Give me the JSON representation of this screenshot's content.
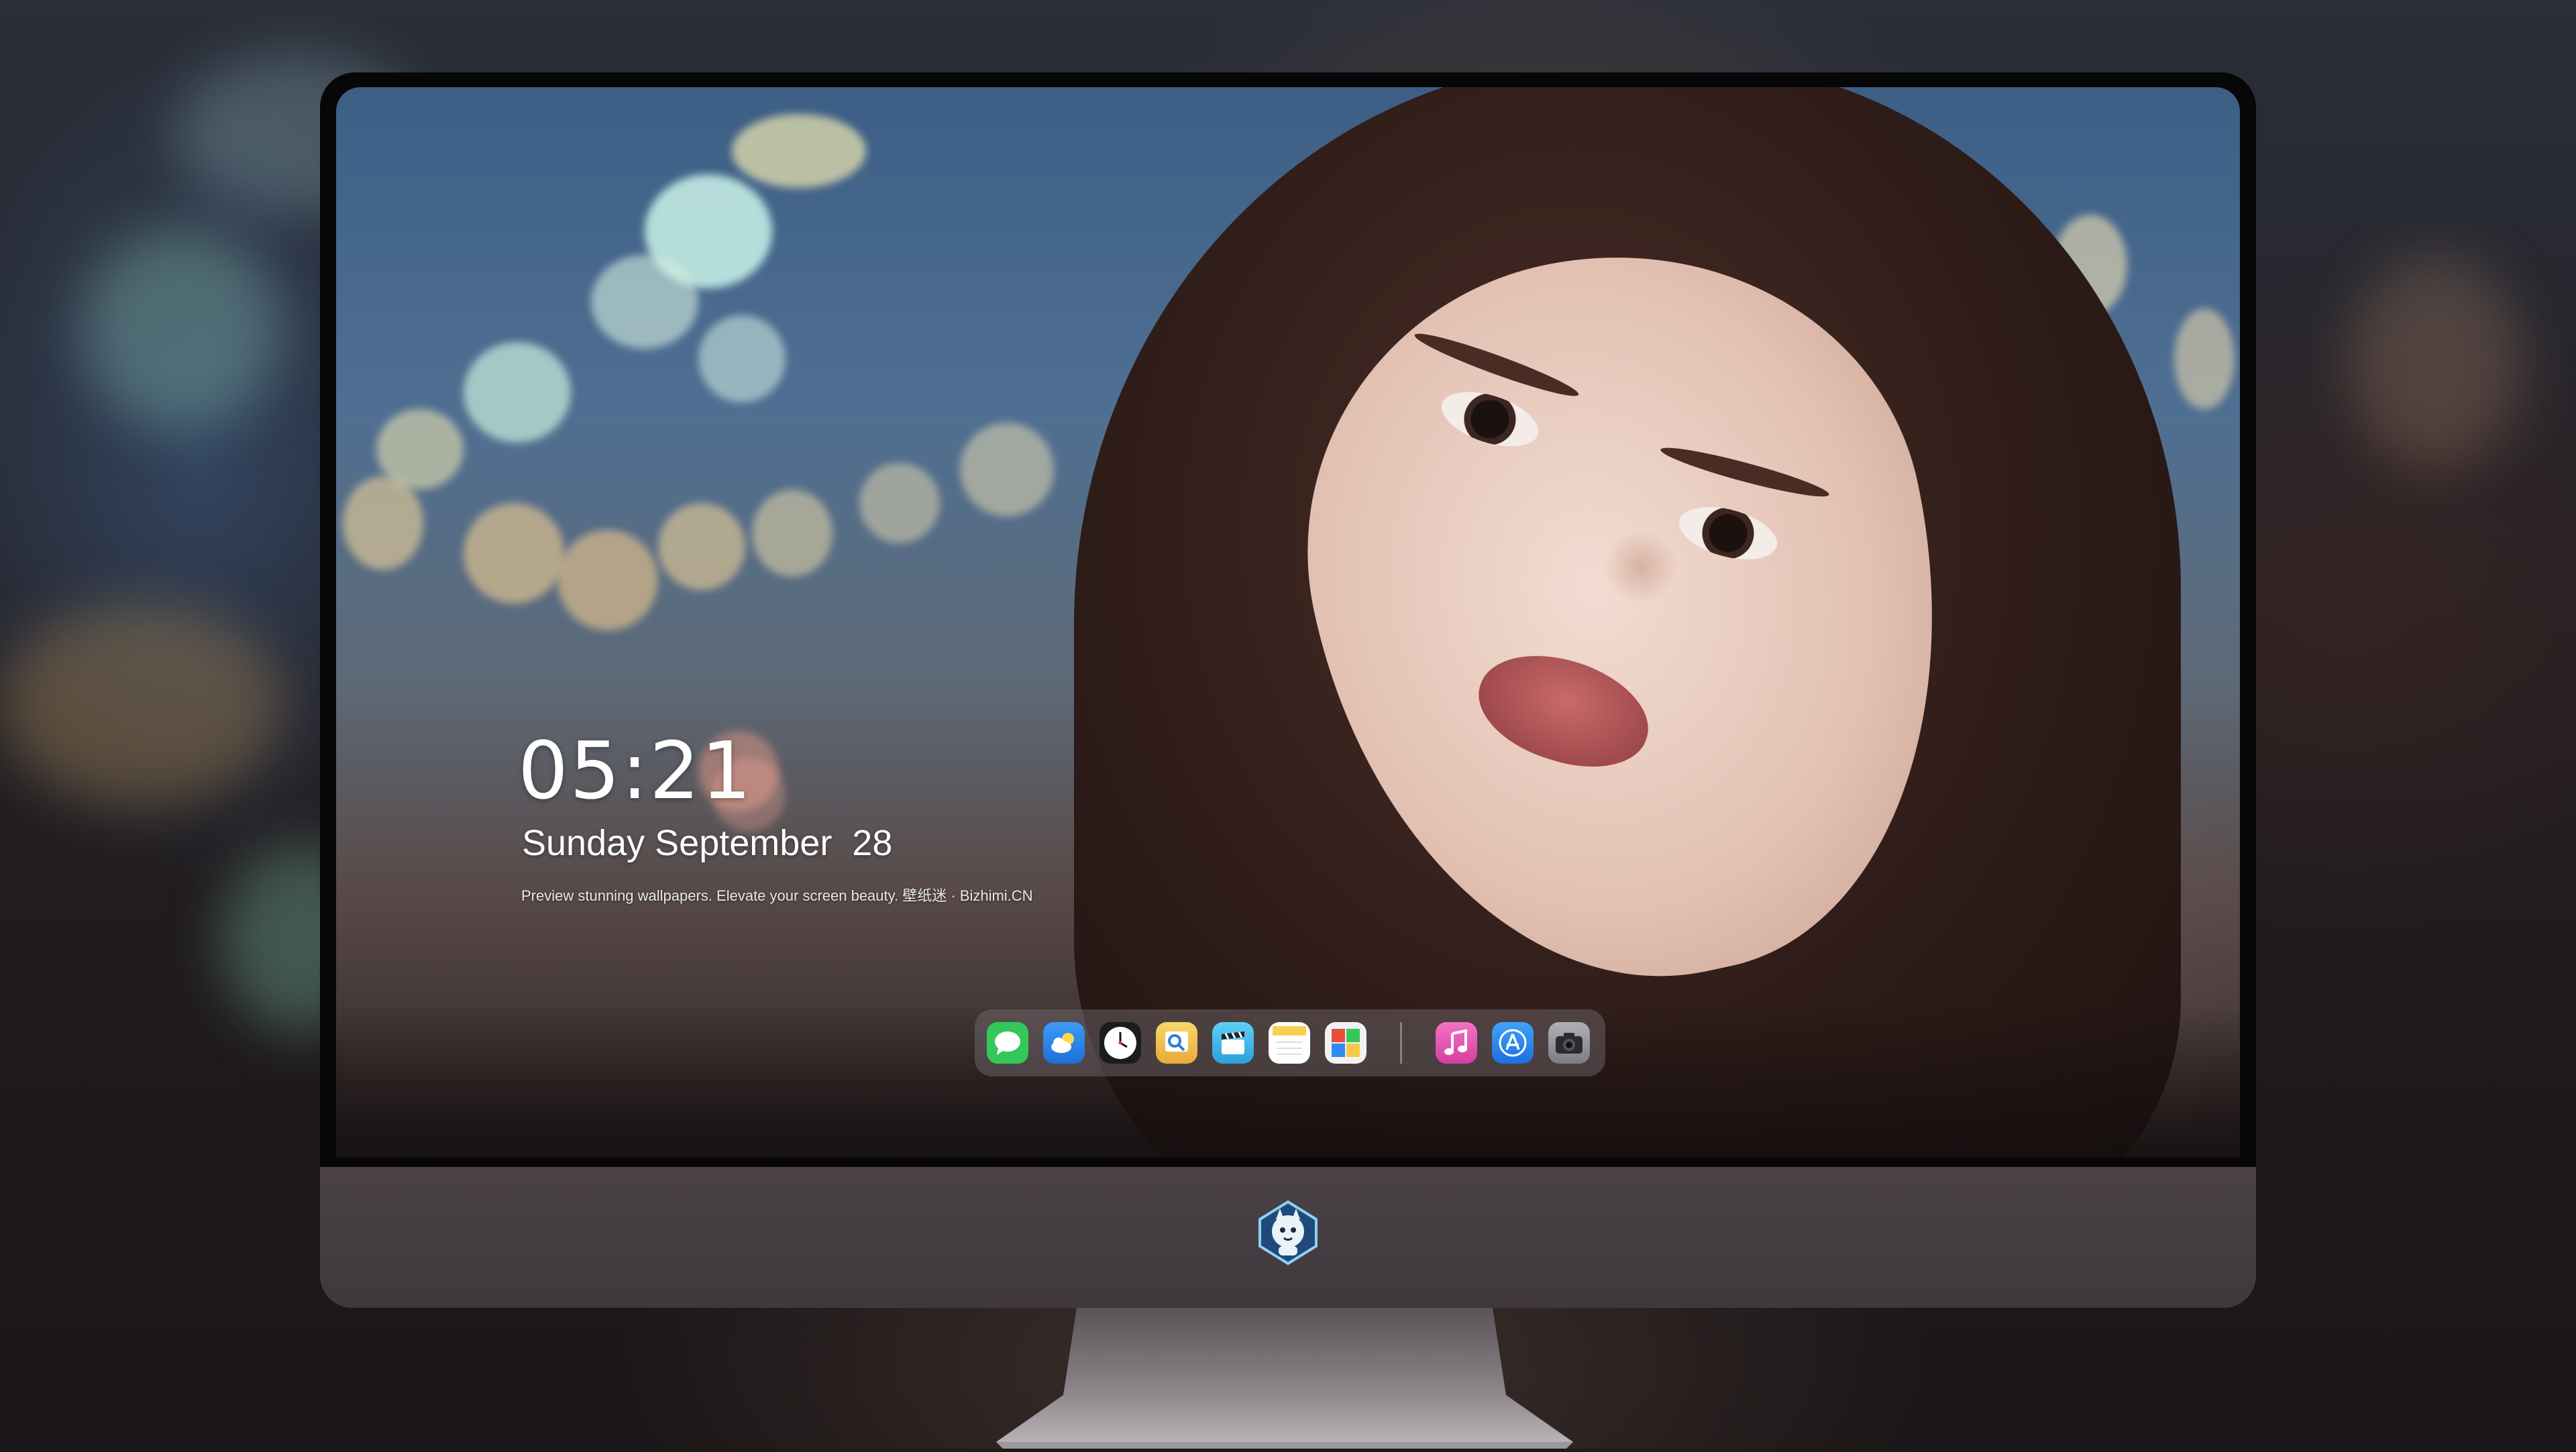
{
  "lockscreen": {
    "time": "05:21",
    "date": "Sunday September  28",
    "tagline": "Preview stunning wallpapers. Elevate your screen beauty. 壁纸迷 · Bizhimi.CN"
  },
  "dock": {
    "apps": [
      {
        "name": "messages-icon",
        "color": "#34c759"
      },
      {
        "name": "weather-icon",
        "color": "#2f8bf5"
      },
      {
        "name": "clock-icon",
        "color": "#1c1c1e"
      },
      {
        "name": "preview-icon",
        "color": "#f4c84a"
      },
      {
        "name": "clips-icon",
        "color": "#3fb6e8"
      },
      {
        "name": "notes-icon",
        "color": "#f7d154"
      },
      {
        "name": "photo-booth-icon",
        "color": "#e94e3c"
      },
      {
        "name": "music-icon",
        "color": "#f05fb0"
      },
      {
        "name": "app-store-icon",
        "color": "#2f8bf5"
      },
      {
        "name": "camera-icon",
        "color": "#8e8e93"
      }
    ]
  },
  "monitor": {
    "logo": "mascot-logo-icon"
  }
}
